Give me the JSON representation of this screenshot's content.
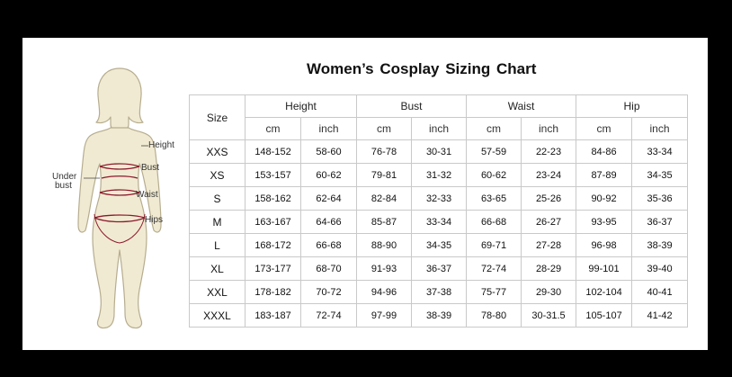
{
  "title": "Women’s  Cosplay Sizing Chart",
  "figure": {
    "icon": "body-silhouette-icon",
    "labels": {
      "height": "Height",
      "bust": "Bust",
      "under_bust_line1": "Under",
      "under_bust_line2": "bust",
      "waist": "Waist",
      "hips": "Hips"
    },
    "colors": {
      "fill": "#f1ead2",
      "stroke": "#b6ad8f",
      "measure": "#8b1a2b"
    }
  },
  "table": {
    "size_header": "Size",
    "groups": [
      "Height",
      "Bust",
      "Waist",
      "Hip"
    ],
    "units": [
      "cm",
      "inch",
      "cm",
      "inch",
      "cm",
      "inch",
      "cm",
      "inch"
    ],
    "rows": [
      {
        "size": "XXS",
        "cells": [
          "148-152",
          "58-60",
          "76-78",
          "30-31",
          "57-59",
          "22-23",
          "84-86",
          "33-34"
        ]
      },
      {
        "size": "XS",
        "cells": [
          "153-157",
          "60-62",
          "79-81",
          "31-32",
          "60-62",
          "23-24",
          "87-89",
          "34-35"
        ]
      },
      {
        "size": "S",
        "cells": [
          "158-162",
          "62-64",
          "82-84",
          "32-33",
          "63-65",
          "25-26",
          "90-92",
          "35-36"
        ]
      },
      {
        "size": "M",
        "cells": [
          "163-167",
          "64-66",
          "85-87",
          "33-34",
          "66-68",
          "26-27",
          "93-95",
          "36-37"
        ]
      },
      {
        "size": "L",
        "cells": [
          "168-172",
          "66-68",
          "88-90",
          "34-35",
          "69-71",
          "27-28",
          "96-98",
          "38-39"
        ]
      },
      {
        "size": "XL",
        "cells": [
          "173-177",
          "68-70",
          "91-93",
          "36-37",
          "72-74",
          "28-29",
          "99-101",
          "39-40"
        ]
      },
      {
        "size": "XXL",
        "cells": [
          "178-182",
          "70-72",
          "94-96",
          "37-38",
          "75-77",
          "29-30",
          "102-104",
          "40-41"
        ]
      },
      {
        "size": "XXXL",
        "cells": [
          "183-187",
          "72-74",
          "97-99",
          "38-39",
          "78-80",
          "30-31.5",
          "105-107",
          "41-42"
        ]
      }
    ],
    "colors": {
      "border": "#c9c9c9"
    }
  }
}
